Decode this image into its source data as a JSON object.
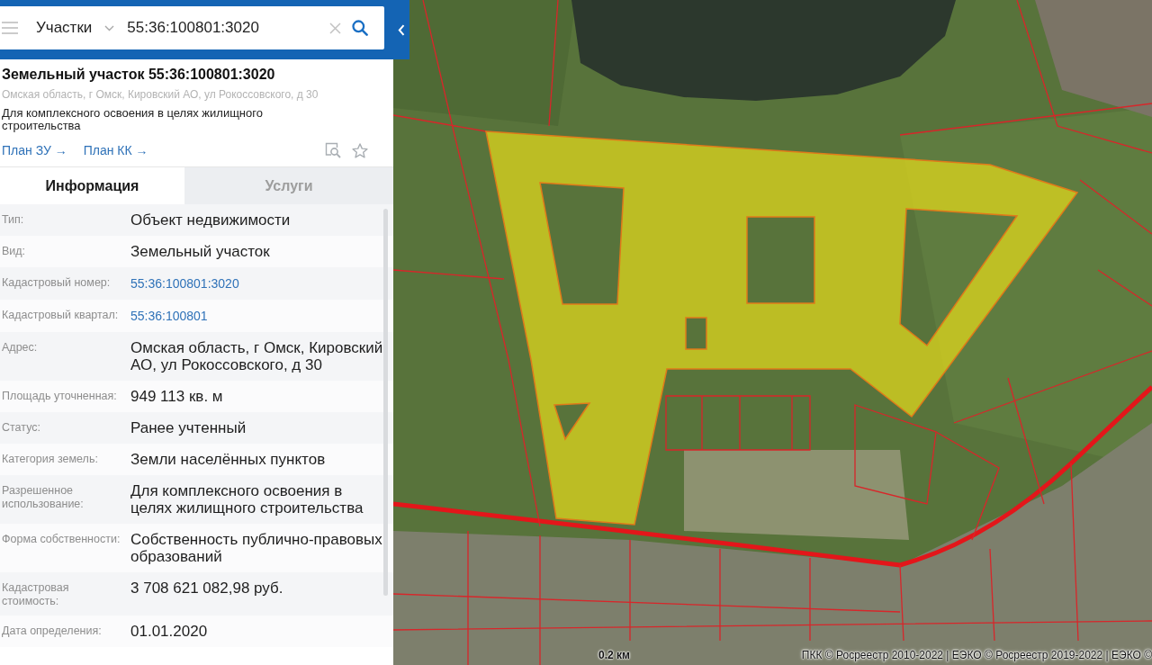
{
  "search": {
    "layer": "Участки",
    "value": "55:36:100801:3020"
  },
  "object": {
    "title": "Земельный участок 55:36:100801:3020",
    "address": "Омская область, г Омск, Кировский АО, ул Рокоссовского, д 30",
    "purpose": "Для комплексного освоения в целях жилищного строительства",
    "links": [
      "План ЗУ →",
      "План КК →"
    ]
  },
  "tabs": [
    {
      "label": "Информация",
      "selected": true
    },
    {
      "label": "Услуги",
      "selected": false
    }
  ],
  "rows": [
    {
      "label": "Тип:",
      "value": "Объект недвижимости",
      "kind": "text"
    },
    {
      "label": "Вид:",
      "value": "Земельный участок",
      "kind": "text"
    },
    {
      "label": "Кадастровый номер:",
      "value": "55:36:100801:3020",
      "kind": "link"
    },
    {
      "label": "Кадастровый квартал:",
      "value": "55:36:100801",
      "kind": "link"
    },
    {
      "label": "Адрес:",
      "value": "Омская область, г Омск, Кировский АО, ул Рокоссовского, д 30",
      "kind": "text"
    },
    {
      "label": "Площадь уточненная:",
      "value": "949 113 кв. м",
      "kind": "text"
    },
    {
      "label": "Статус:",
      "value": "Ранее учтенный",
      "kind": "text"
    },
    {
      "label": "Категория земель:",
      "value": "Земли населённых пунктов",
      "kind": "text"
    },
    {
      "label": "Разрешенное использование:",
      "value": "Для комплексного освоения в целях жилищного строительства",
      "kind": "text"
    },
    {
      "label": "Форма собственности:",
      "value": "Собственность публично-правовых образований",
      "kind": "text"
    },
    {
      "label": "Кадастровая стоимость:",
      "value": "3 708 621 082,98 руб.",
      "kind": "text"
    },
    {
      "label": "Дата определения:",
      "value": "01.01.2020",
      "kind": "text"
    }
  ],
  "map": {
    "scale": "0.2 км",
    "attribution": "ПКК © Росреестр 2010-2022 | ЕЭКО © Росреестр 2019-2022 | ЕЭКО ©"
  }
}
